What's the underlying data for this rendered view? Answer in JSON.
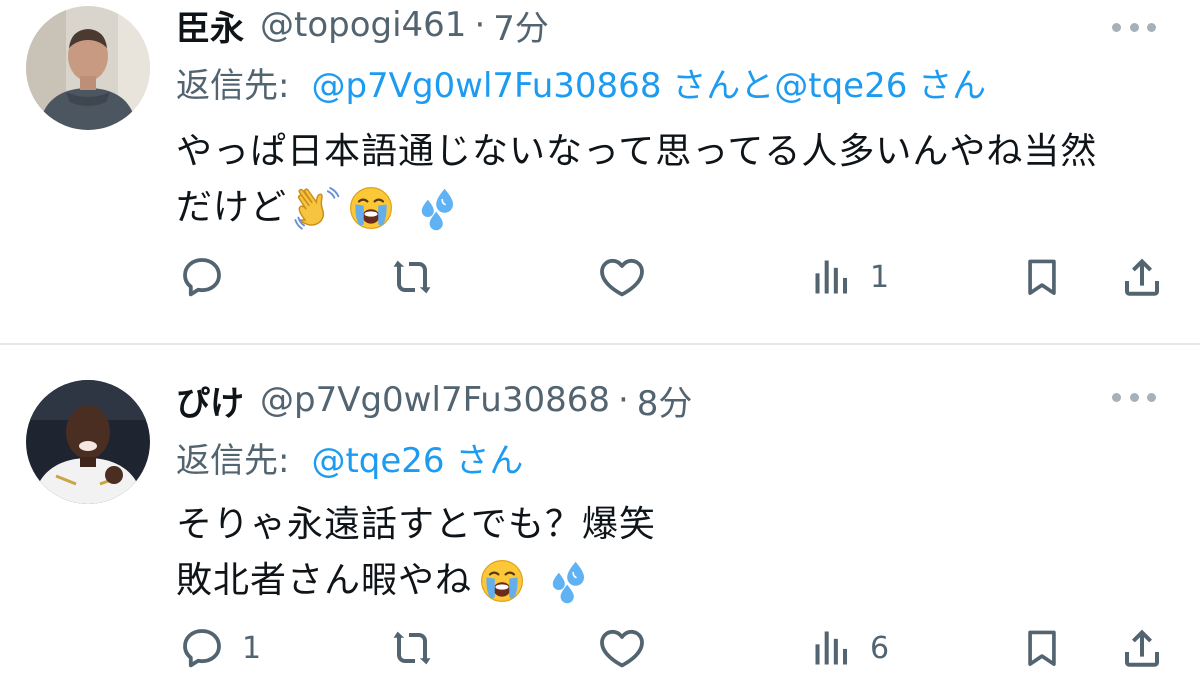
{
  "tweets": [
    {
      "display_name": "臣永",
      "handle": "@topogi461",
      "separator": "·",
      "time": "7分",
      "reply_prefix": "返信先:",
      "mentions": [
        "@p7Vg0wl7Fu30868 さん",
        "と",
        "@tqe26 さん"
      ],
      "body_lines": [
        "やっぱ日本語通じないなって思ってる人多いんやね当然",
        "だけど"
      ],
      "emojis": [
        "waving-hand-emoji",
        "loudly-crying-emoji",
        "sweat-droplets-emoji"
      ],
      "reply_count": "",
      "retweet_count": "",
      "like_count": "",
      "view_count": "1"
    },
    {
      "display_name": "ぴけ",
      "handle": "@p7Vg0wl7Fu30868",
      "separator": "·",
      "time": "8分",
      "reply_prefix": "返信先:",
      "mentions": [
        "@tqe26 さん"
      ],
      "body_lines": [
        "そりゃ永遠話すとでも？爆笑",
        "敗北者さん暇やね"
      ],
      "emojis": [
        "loudly-crying-emoji",
        "sweat-droplets-emoji"
      ],
      "reply_count": "1",
      "retweet_count": "",
      "like_count": "",
      "view_count": "6"
    }
  ],
  "colors": {
    "text": "#0f1419",
    "secondary": "#536471",
    "accent": "#1d9bf0",
    "divider": "#e6e9ec"
  },
  "icons": [
    "reply-icon",
    "retweet-icon",
    "like-icon",
    "views-icon",
    "bookmark-icon",
    "share-icon",
    "more-icon"
  ]
}
